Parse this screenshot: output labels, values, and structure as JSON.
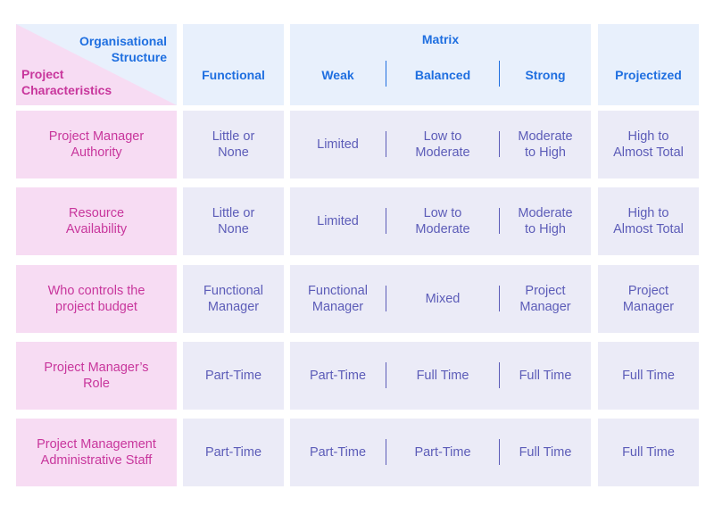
{
  "corner": {
    "top_right_label": "Organisational Structure",
    "top_right_line1": "Organisational",
    "top_right_line2": "Structure",
    "bottom_left_line1": "Project",
    "bottom_left_line2": "Characteristics"
  },
  "headers": {
    "functional": "Functional",
    "matrix": "Matrix",
    "weak": "Weak",
    "balanced": "Balanced",
    "strong": "Strong",
    "projectized": "Projectized"
  },
  "colors": {
    "header_bg": "#e8f0fc",
    "header_text": "#1f6fe0",
    "row_label_bg": "#f7dcf3",
    "row_label_text": "#c8369c",
    "cell_bg": "#ebebf7",
    "cell_text": "#5c5cb8"
  },
  "rows": [
    {
      "label": [
        "Project Manager",
        "Authority"
      ],
      "functional": [
        "Little or",
        "None"
      ],
      "weak": [
        "Limited"
      ],
      "balanced": [
        "Low to",
        "Moderate"
      ],
      "strong": [
        "Moderate",
        "to High"
      ],
      "projectized": [
        "High to",
        "Almost Total"
      ]
    },
    {
      "label": [
        "Resource",
        "Availability"
      ],
      "functional": [
        "Little or",
        "None"
      ],
      "weak": [
        "Limited"
      ],
      "balanced": [
        "Low to",
        "Moderate"
      ],
      "strong": [
        "Moderate",
        "to High"
      ],
      "projectized": [
        "High to",
        "Almost Total"
      ]
    },
    {
      "label": [
        "Who controls the",
        "project budget"
      ],
      "functional": [
        "Functional",
        "Manager"
      ],
      "weak": [
        "Functional",
        "Manager"
      ],
      "balanced": [
        "Mixed"
      ],
      "strong": [
        "Project",
        "Manager"
      ],
      "projectized": [
        "Project",
        "Manager"
      ]
    },
    {
      "label": [
        "Project Manager’s",
        "Role"
      ],
      "functional": [
        "Part-Time"
      ],
      "weak": [
        "Part-Time"
      ],
      "balanced": [
        "Full Time"
      ],
      "strong": [
        "Full Time"
      ],
      "projectized": [
        "Full Time"
      ]
    },
    {
      "label": [
        "Project Management",
        "Administrative Staff"
      ],
      "functional": [
        "Part-Time"
      ],
      "weak": [
        "Part-Time"
      ],
      "balanced": [
        "Part-Time"
      ],
      "strong": [
        "Full Time"
      ],
      "projectized": [
        "Full Time"
      ]
    }
  ]
}
